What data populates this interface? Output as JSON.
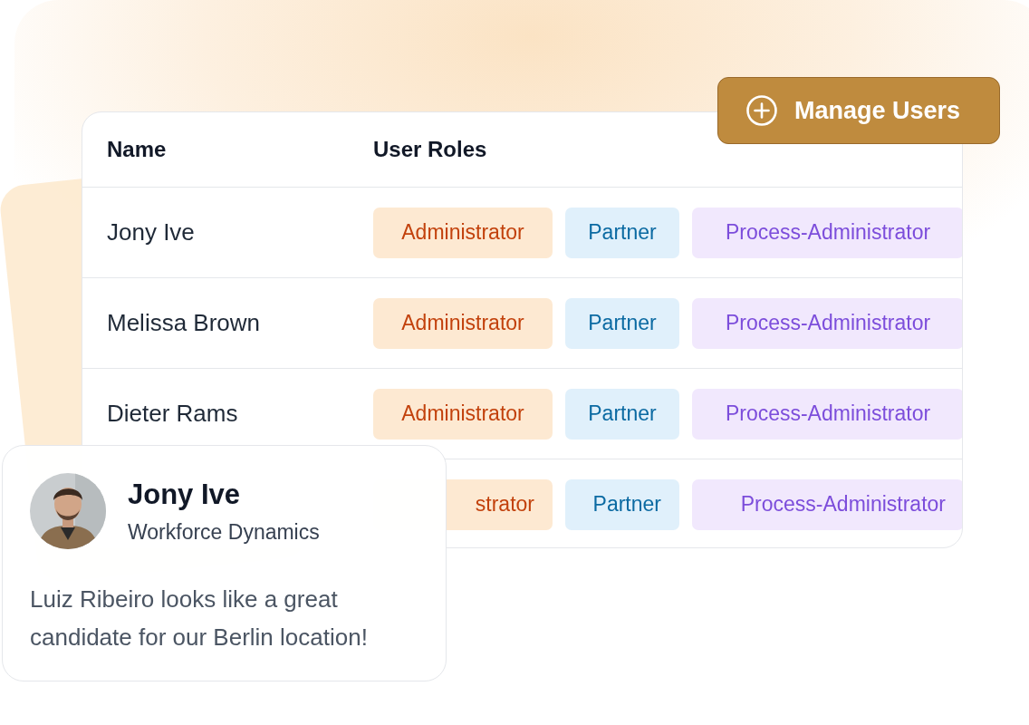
{
  "button": {
    "label": "Manage Users"
  },
  "table": {
    "columns": [
      "Name",
      "User Roles"
    ],
    "rows": [
      {
        "name": "Jony Ive",
        "roles": [
          {
            "kind": "admin",
            "label": "Administrator"
          },
          {
            "kind": "partner",
            "label": "Partner"
          },
          {
            "kind": "process",
            "label": "Process-Administrator"
          }
        ]
      },
      {
        "name": "Melissa Brown",
        "roles": [
          {
            "kind": "admin",
            "label": "Administrator"
          },
          {
            "kind": "partner",
            "label": "Partner"
          },
          {
            "kind": "process",
            "label": "Process-Administrator"
          }
        ]
      },
      {
        "name": "Dieter Rams",
        "roles": [
          {
            "kind": "admin",
            "label": "Administrator"
          },
          {
            "kind": "partner",
            "label": "Partner"
          },
          {
            "kind": "process",
            "label": "Process-Administrator"
          }
        ]
      },
      {
        "roles": [
          {
            "kind": "admin",
            "label": "strator"
          },
          {
            "kind": "partner",
            "label": "Partner"
          },
          {
            "kind": "process",
            "label": "Process-Administrator"
          }
        ]
      }
    ]
  },
  "profile_card": {
    "name": "Jony Ive",
    "company": "Workforce Dynamics",
    "message": "Luiz Ribeiro looks like a great candidate for our Berlin location!"
  }
}
